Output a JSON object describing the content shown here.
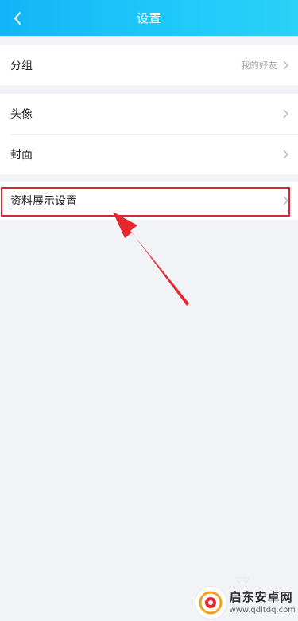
{
  "header": {
    "title": "设置",
    "back_icon": "chevron-left-icon",
    "gradient_colors": [
      "#14b4f8",
      "#2ad2f7"
    ]
  },
  "groups": [
    {
      "rows": [
        {
          "label": "分组",
          "value": "我的好友"
        }
      ]
    },
    {
      "rows": [
        {
          "label": "头像"
        },
        {
          "label": "封面"
        }
      ]
    },
    {
      "rows": [
        {
          "label": "资料展示设置",
          "highlighted": true
        }
      ]
    }
  ],
  "annotation": {
    "color": "#d9272e",
    "arrow_target": "资料展示设置"
  },
  "watermark": {
    "name": "启东安卓网",
    "url": "www.qdltdq.com"
  }
}
